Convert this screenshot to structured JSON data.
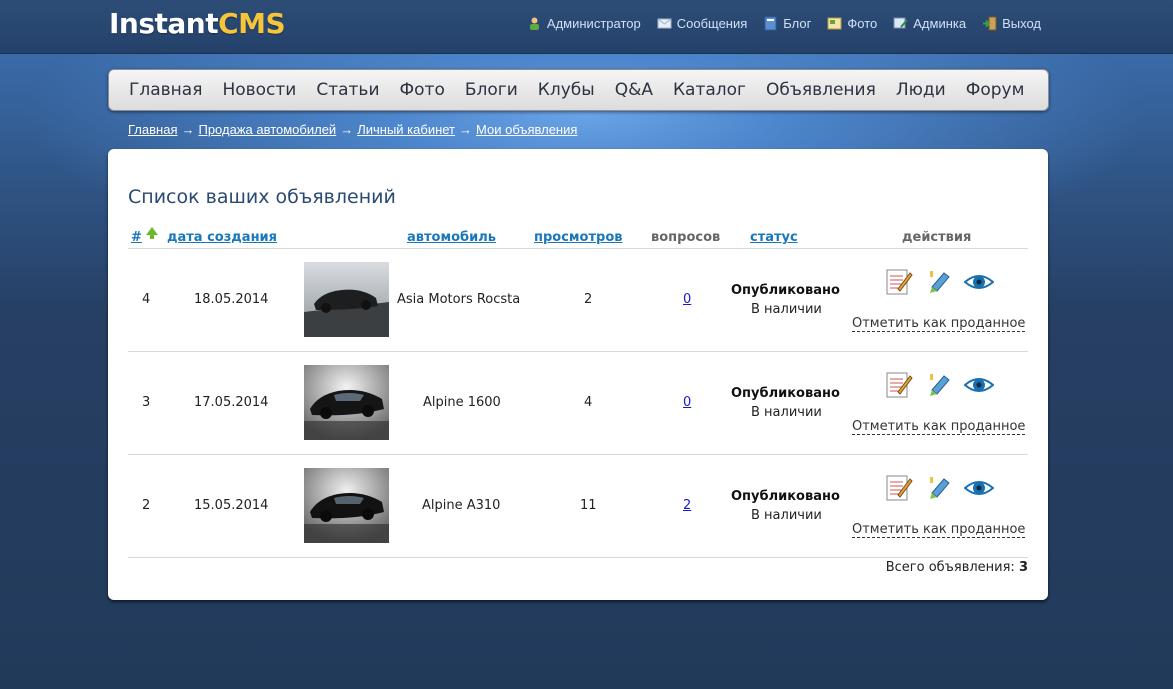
{
  "logo": {
    "part1": "Instant",
    "part2": "CMS"
  },
  "usermenu": [
    {
      "label": "Администратор",
      "icon": "user-icon"
    },
    {
      "label": "Сообщения",
      "icon": "envelope-icon"
    },
    {
      "label": "Блог",
      "icon": "blog-icon"
    },
    {
      "label": "Фото",
      "icon": "photo-icon"
    },
    {
      "label": "Админка",
      "icon": "admin-icon"
    },
    {
      "label": "Выход",
      "icon": "logout-icon"
    }
  ],
  "nav": [
    "Главная",
    "Новости",
    "Статьи",
    "Фото",
    "Блоги",
    "Клубы",
    "Q&A",
    "Каталог",
    "Объявления",
    "Люди",
    "Форум"
  ],
  "breadcrumb": [
    "Главная",
    "Продажа автомобилей",
    "Личный кабинет",
    "Мои объявления"
  ],
  "breadcrumb_sep": "→",
  "page_title": "Список ваших объявлений",
  "columns": {
    "num": "#",
    "date": "дата создания",
    "car": "автомобиль",
    "views": "просмотров",
    "questions": "вопросов",
    "status": "статус",
    "actions": "действия"
  },
  "rows": [
    {
      "id": "4",
      "date": "18.05.2014",
      "car": "Asia Motors Rocsta",
      "views": "2",
      "questions": "0",
      "status": "Опубликовано",
      "availability": "В наличии",
      "sold_label": "Отметить как проданное"
    },
    {
      "id": "3",
      "date": "17.05.2014",
      "car": "Alpine 1600",
      "views": "4",
      "questions": "0",
      "status": "Опубликовано",
      "availability": "В наличии",
      "sold_label": "Отметить как проданное"
    },
    {
      "id": "2",
      "date": "15.05.2014",
      "car": "Alpine A310",
      "views": "11",
      "questions": "2",
      "status": "Опубликовано",
      "availability": "В наличии",
      "sold_label": "Отметить как проданное"
    }
  ],
  "total": {
    "label": "Всего объявления:",
    "value": "3"
  },
  "colors": {
    "accent_link": "#1a78b8",
    "logo_accent": "#f7c53a",
    "title": "#2a4a72"
  }
}
